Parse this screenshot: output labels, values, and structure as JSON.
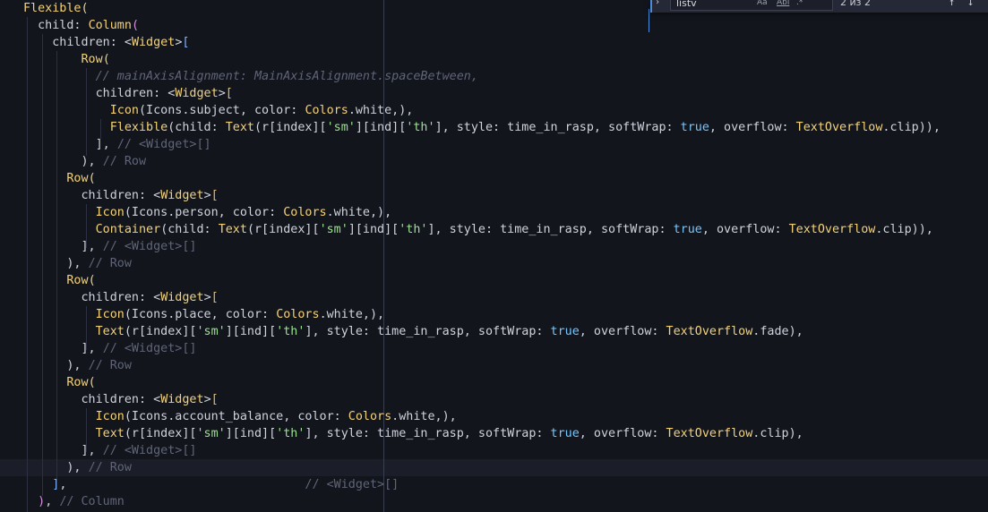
{
  "find_widget": {
    "toggle_icon": "chevron-right",
    "search_value": "listv",
    "match_case_label": "Aa",
    "whole_word_label": "Abl",
    "regex_label": ".*",
    "result_count": "2 из 2",
    "prev_icon": "arrow-up",
    "next_icon": "arrow-down"
  },
  "code_lines": [
    {
      "tokens": [
        {
          "c": "class",
          "t": "Flexible"
        },
        {
          "c": "br",
          "t": "("
        }
      ]
    },
    {
      "tokens": [
        {
          "c": "plain",
          "t": "  child: "
        },
        {
          "c": "class",
          "t": "Column"
        },
        {
          "c": "brp",
          "t": "("
        }
      ]
    },
    {
      "tokens": [
        {
          "c": "plain",
          "t": "    children: <"
        },
        {
          "c": "class",
          "t": "Widget"
        },
        {
          "c": "plain",
          "t": ">"
        },
        {
          "c": "brb",
          "t": "["
        }
      ]
    },
    {
      "tokens": [
        {
          "c": "plain",
          "t": "        "
        },
        {
          "c": "class",
          "t": "Row"
        },
        {
          "c": "br",
          "t": "("
        }
      ]
    },
    {
      "tokens": [
        {
          "c": "plain",
          "t": "          "
        },
        {
          "c": "comi",
          "t": "// mainAxisAlignment: MainAxisAlignment.spaceBetween,"
        }
      ]
    },
    {
      "tokens": [
        {
          "c": "plain",
          "t": "          children: <"
        },
        {
          "c": "class",
          "t": "Widget"
        },
        {
          "c": "plain",
          "t": ">"
        },
        {
          "c": "brg",
          "t": "["
        }
      ]
    },
    {
      "tokens": [
        {
          "c": "plain",
          "t": "            "
        },
        {
          "c": "class",
          "t": "Icon"
        },
        {
          "c": "plain",
          "t": "(Icons.subject, color: "
        },
        {
          "c": "class",
          "t": "Colors"
        },
        {
          "c": "plain",
          "t": ".white,),"
        }
      ]
    },
    {
      "tokens": [
        {
          "c": "plain",
          "t": "            "
        },
        {
          "c": "class",
          "t": "Flexible"
        },
        {
          "c": "plain",
          "t": "(child: "
        },
        {
          "c": "class",
          "t": "Text"
        },
        {
          "c": "plain",
          "t": "(r[index]["
        },
        {
          "c": "str",
          "t": "'sm'"
        },
        {
          "c": "plain",
          "t": "][ind]["
        },
        {
          "c": "str",
          "t": "'th'"
        },
        {
          "c": "plain",
          "t": "], style: time_in_rasp, softWrap: "
        },
        {
          "c": "kw",
          "t": "true"
        },
        {
          "c": "plain",
          "t": ", overflow: "
        },
        {
          "c": "class",
          "t": "TextOverflow"
        },
        {
          "c": "plain",
          "t": ".clip)),"
        }
      ]
    },
    {
      "tokens": [
        {
          "c": "plain",
          "t": "          ], "
        },
        {
          "c": "com",
          "t": "// <Widget>[]"
        }
      ]
    },
    {
      "tokens": [
        {
          "c": "plain",
          "t": "        ), "
        },
        {
          "c": "com",
          "t": "// Row"
        }
      ]
    },
    {
      "tokens": [
        {
          "c": "plain",
          "t": "      "
        },
        {
          "c": "class",
          "t": "Row"
        },
        {
          "c": "br",
          "t": "("
        }
      ]
    },
    {
      "tokens": [
        {
          "c": "plain",
          "t": "        children: <"
        },
        {
          "c": "class",
          "t": "Widget"
        },
        {
          "c": "plain",
          "t": ">"
        },
        {
          "c": "brg",
          "t": "["
        }
      ]
    },
    {
      "tokens": [
        {
          "c": "plain",
          "t": "          "
        },
        {
          "c": "class",
          "t": "Icon"
        },
        {
          "c": "plain",
          "t": "(Icons.person, color: "
        },
        {
          "c": "class",
          "t": "Colors"
        },
        {
          "c": "plain",
          "t": ".white,),"
        }
      ]
    },
    {
      "tokens": [
        {
          "c": "plain",
          "t": "          "
        },
        {
          "c": "class",
          "t": "Container"
        },
        {
          "c": "plain",
          "t": "(child: "
        },
        {
          "c": "class",
          "t": "Text"
        },
        {
          "c": "plain",
          "t": "(r[index]["
        },
        {
          "c": "str",
          "t": "'sm'"
        },
        {
          "c": "plain",
          "t": "][ind]["
        },
        {
          "c": "str",
          "t": "'th'"
        },
        {
          "c": "plain",
          "t": "], style: time_in_rasp, softWrap: "
        },
        {
          "c": "kw",
          "t": "true"
        },
        {
          "c": "plain",
          "t": ", overflow: "
        },
        {
          "c": "class",
          "t": "TextOverflow"
        },
        {
          "c": "plain",
          "t": ".clip)),"
        }
      ]
    },
    {
      "tokens": [
        {
          "c": "plain",
          "t": "        ], "
        },
        {
          "c": "com",
          "t": "// <Widget>[]"
        }
      ]
    },
    {
      "tokens": [
        {
          "c": "plain",
          "t": "      ), "
        },
        {
          "c": "com",
          "t": "// Row"
        }
      ]
    },
    {
      "tokens": [
        {
          "c": "plain",
          "t": "      "
        },
        {
          "c": "class",
          "t": "Row"
        },
        {
          "c": "br",
          "t": "("
        }
      ]
    },
    {
      "tokens": [
        {
          "c": "plain",
          "t": "        children: <"
        },
        {
          "c": "class",
          "t": "Widget"
        },
        {
          "c": "plain",
          "t": ">"
        },
        {
          "c": "brg",
          "t": "["
        }
      ]
    },
    {
      "tokens": [
        {
          "c": "plain",
          "t": "          "
        },
        {
          "c": "class",
          "t": "Icon"
        },
        {
          "c": "plain",
          "t": "(Icons.place, color: "
        },
        {
          "c": "class",
          "t": "Colors"
        },
        {
          "c": "plain",
          "t": ".white,),"
        }
      ]
    },
    {
      "tokens": [
        {
          "c": "plain",
          "t": "          "
        },
        {
          "c": "class",
          "t": "Text"
        },
        {
          "c": "plain",
          "t": "(r[index]["
        },
        {
          "c": "str",
          "t": "'sm'"
        },
        {
          "c": "plain",
          "t": "][ind]["
        },
        {
          "c": "str",
          "t": "'th'"
        },
        {
          "c": "plain",
          "t": "], style: time_in_rasp, softWrap: "
        },
        {
          "c": "kw",
          "t": "true"
        },
        {
          "c": "plain",
          "t": ", overflow: "
        },
        {
          "c": "class",
          "t": "TextOverflow"
        },
        {
          "c": "plain",
          "t": ".fade),"
        }
      ]
    },
    {
      "tokens": [
        {
          "c": "plain",
          "t": "        ], "
        },
        {
          "c": "com",
          "t": "// <Widget>[]"
        }
      ]
    },
    {
      "tokens": [
        {
          "c": "plain",
          "t": "      ), "
        },
        {
          "c": "com",
          "t": "// Row"
        }
      ]
    },
    {
      "tokens": [
        {
          "c": "plain",
          "t": "      "
        },
        {
          "c": "class",
          "t": "Row"
        },
        {
          "c": "br",
          "t": "("
        }
      ]
    },
    {
      "tokens": [
        {
          "c": "plain",
          "t": "        children: <"
        },
        {
          "c": "class",
          "t": "Widget"
        },
        {
          "c": "plain",
          "t": ">"
        },
        {
          "c": "brg",
          "t": "["
        }
      ]
    },
    {
      "tokens": [
        {
          "c": "plain",
          "t": "          "
        },
        {
          "c": "class",
          "t": "Icon"
        },
        {
          "c": "plain",
          "t": "(Icons.account_balance, color: "
        },
        {
          "c": "class",
          "t": "Colors"
        },
        {
          "c": "plain",
          "t": ".white,),"
        }
      ]
    },
    {
      "tokens": [
        {
          "c": "plain",
          "t": "          "
        },
        {
          "c": "class",
          "t": "Text"
        },
        {
          "c": "plain",
          "t": "(r[index]["
        },
        {
          "c": "str",
          "t": "'sm'"
        },
        {
          "c": "plain",
          "t": "][ind]["
        },
        {
          "c": "str",
          "t": "'th'"
        },
        {
          "c": "plain",
          "t": "], style: time_in_rasp, softWrap: "
        },
        {
          "c": "kw",
          "t": "true"
        },
        {
          "c": "plain",
          "t": ", overflow: "
        },
        {
          "c": "class",
          "t": "TextOverflow"
        },
        {
          "c": "plain",
          "t": ".clip),"
        }
      ]
    },
    {
      "tokens": [
        {
          "c": "plain",
          "t": "        ], "
        },
        {
          "c": "com",
          "t": "// <Widget>[]"
        }
      ]
    },
    {
      "tokens": [
        {
          "c": "plain",
          "t": "      ), "
        },
        {
          "c": "com",
          "t": "// Row"
        }
      ]
    },
    {
      "tokens": [
        {
          "c": "plain",
          "t": "    "
        },
        {
          "c": "brb",
          "t": "]"
        },
        {
          "c": "plain",
          "t": ",                                 "
        },
        {
          "c": "com",
          "t": "// <Widget>[]"
        }
      ]
    },
    {
      "tokens": [
        {
          "c": "plain",
          "t": "  "
        },
        {
          "c": "brp",
          "t": ")"
        },
        {
          "c": "plain",
          "t": ", "
        },
        {
          "c": "com",
          "t": "// Column"
        }
      ]
    }
  ]
}
